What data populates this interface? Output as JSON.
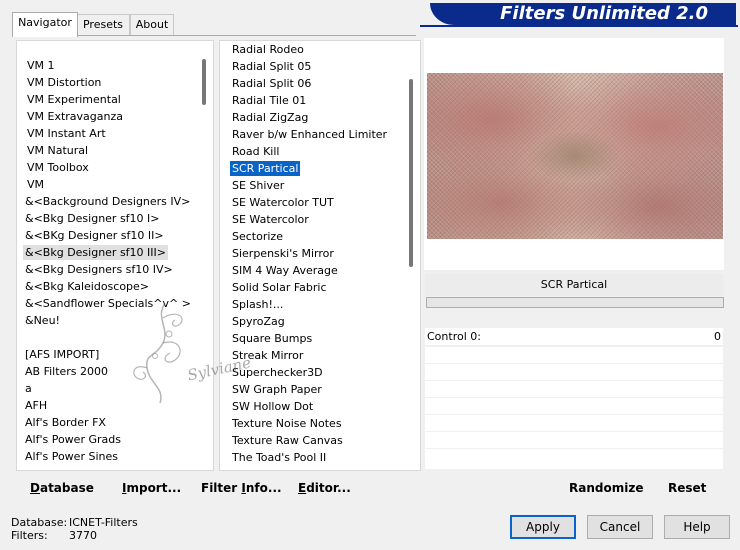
{
  "tabs": [
    "Navigator",
    "Presets",
    "About"
  ],
  "banner": "Filters Unlimited 2.0",
  "category_list": [
    "VM 1",
    "VM Distortion",
    "VM Experimental",
    "VM Extravaganza",
    "VM Instant Art",
    "VM Natural",
    "VM Toolbox",
    "VM",
    "&<Background Designers IV>",
    "&<Bkg Designer sf10 I>",
    "&<BKg Designer sf10 II>",
    "&<Bkg Designer sf10 III>",
    "&<Bkg Designers sf10 IV>",
    "&<Bkg Kaleidoscope>",
    "&<Sandflower Specials^v^ >",
    "&Neu!",
    "",
    "[AFS IMPORT]",
    "AB Filters 2000",
    "a",
    "AFH",
    "Alf's Border FX",
    "Alf's Power Grads",
    "Alf's Power Sines"
  ],
  "category_highlight": "&<Bkg Designer sf10 III>",
  "filter_list": [
    "Radial Rodeo",
    "Radial Split 05",
    "Radial Split 06",
    "Radial Tile 01",
    "Radial ZigZag",
    "Raver b/w Enhanced Limiter",
    "Road Kill",
    "SCR  Partical",
    "SE Shiver",
    "SE Watercolor TUT",
    "SE Watercolor",
    "Sectorize",
    "Sierpenski's Mirror",
    "SIM 4 Way Average",
    "Solid Solar Fabric",
    "Splash!...",
    "SpyroZag",
    "Square Bumps",
    "Streak Mirror",
    "Superchecker3D",
    "SW Graph Paper",
    "SW Hollow Dot",
    "Texture Noise Notes",
    "Texture Raw Canvas",
    "The Toad's Pool II"
  ],
  "selected_filter": "SCR  Partical",
  "preview": {
    "filter_name": "SCR  Partical",
    "control_label": "Control 0:",
    "control_value": "0"
  },
  "watermark": "Sylviane",
  "bottom_buttons": {
    "database": "Database",
    "import": "Import...",
    "filter_info": "Filter Info...",
    "editor": "Editor...",
    "randomize": "Randomize",
    "reset": "Reset"
  },
  "status": {
    "database_label": "Database:",
    "database_value": "ICNET-Filters",
    "filters_label": "Filters:",
    "filters_value": "3770"
  },
  "dialog_buttons": {
    "apply": "Apply",
    "cancel": "Cancel",
    "help": "Help"
  },
  "colors": {
    "banner": "#0b2b8c",
    "selection": "#0a64c8"
  }
}
